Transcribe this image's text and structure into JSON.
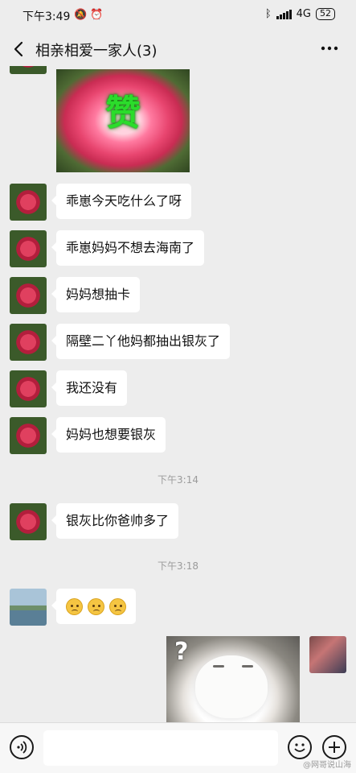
{
  "status_bar": {
    "time": "下午3:49",
    "left_icons": [
      "notification-off-icon",
      "alarm-icon"
    ],
    "bluetooth_icon": "bluetooth-icon",
    "signal_icon": "signal-icon",
    "network": "4G",
    "battery": "52"
  },
  "header": {
    "title": "相亲相爱一家人(3)",
    "back_icon": "back-arrow-icon",
    "more_icon": "more-icon"
  },
  "chat": {
    "image_text": "赞",
    "messages": [
      {
        "text": "乖崽今天吃什么了呀"
      },
      {
        "text": "乖崽妈妈不想去海南了"
      },
      {
        "text": "妈妈想抽卡"
      },
      {
        "text": "隔壁二丫他妈都抽出银灰了"
      },
      {
        "text": "我还没有"
      },
      {
        "text": "妈妈也想要银灰"
      },
      {
        "text": "银灰比你爸帅多了"
      }
    ],
    "timestamps": [
      "下午3:14",
      "下午3:18"
    ],
    "emoji_reply": [
      "sad-face-emoji",
      "sad-face-emoji",
      "sad-face-emoji"
    ],
    "cat_image_icon": "question-mark-icon"
  },
  "input_bar": {
    "voice_icon": "voice-icon",
    "emoji_icon": "emoji-icon",
    "plus_icon": "plus-icon"
  },
  "watermark": "@网哥说山海"
}
